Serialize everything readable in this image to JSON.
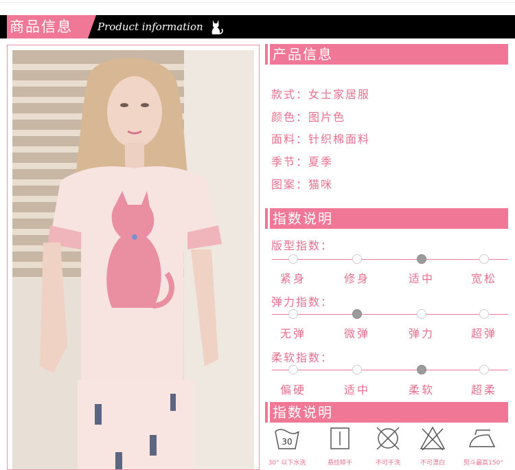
{
  "header": {
    "title_cn": "商品信息",
    "title_en": "Product information",
    "cat_icon": "cat-silhouette-icon"
  },
  "colors": {
    "accent": "#f07896",
    "text": "#e8708f",
    "header_bg": "#000000"
  },
  "product_info": {
    "title": "产品信息",
    "rows": [
      {
        "text": "款式：女士家居服"
      },
      {
        "text": "颜色：图片色"
      },
      {
        "text": "面料：针织棉面料"
      },
      {
        "text": "季节：夏季"
      },
      {
        "text": "图案：猫咪"
      }
    ]
  },
  "index": {
    "title": "指数说明",
    "scales": [
      {
        "title": "版型指数：",
        "labels": [
          "紧身",
          "修身",
          "适中",
          "宽松"
        ],
        "selected_index": 2
      },
      {
        "title": "弹力指数：",
        "labels": [
          "无弹",
          "微弹",
          "弹力",
          "超弹"
        ],
        "selected_index": 1
      },
      {
        "title": "柔软指数：",
        "labels": [
          "偏硬",
          "适中",
          "柔软",
          "超柔"
        ],
        "selected_index": 2
      }
    ]
  },
  "care": {
    "title": "指数说明",
    "items": [
      {
        "icon": "wash-30-icon",
        "label": "30° 以下水洗",
        "icon_text": "30"
      },
      {
        "icon": "hang-dry-icon",
        "label": "悬挂晾干"
      },
      {
        "icon": "no-dry-clean-icon",
        "label": "不可干洗"
      },
      {
        "icon": "no-bleach-icon",
        "label": "不可漂白"
      },
      {
        "icon": "iron-150-icon",
        "label": "熨斗最高150°"
      }
    ]
  }
}
